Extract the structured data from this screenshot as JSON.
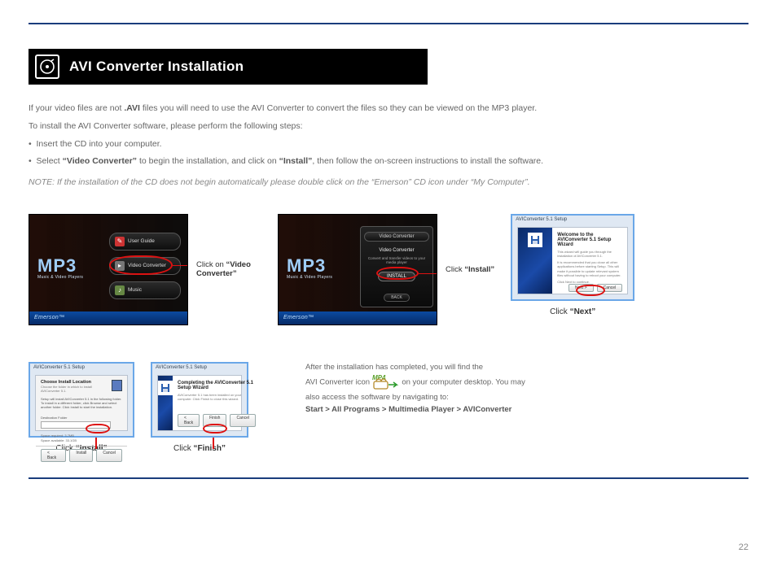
{
  "header": {
    "title": "AVI Converter Installation"
  },
  "intro": {
    "p1_a": "If your video files are not ",
    "p1_b": ".AVI",
    "p1_c": " files you will need to use the AVI Converter to convert the files so they can be viewed on the MP3 player.",
    "p2": "To install the AVI Converter software, please perform the following steps:",
    "li1": "Insert the CD into your computer.",
    "li2_a": "Select ",
    "li2_b": "“Video Converter”",
    "li2_c": " to begin the installation, and click on ",
    "li2_d": "“Install”",
    "li2_e": ", then follow the on-screen instructions to install the software.",
    "note": "NOTE: If the installation of the CD does not begin automatically please double click on the “Emerson” CD icon under “My Computer”."
  },
  "captions": {
    "c1_a": "Click on ",
    "c1_b": "“Video Converter”",
    "c2_a": "Click ",
    "c2_b": "“Install”",
    "c3_a": "Click ",
    "c3_b": "“Next”",
    "c4_a": "Click ",
    "c4_b": "“Install”",
    "c5_a": "Click ",
    "c5_b": "“Finish”"
  },
  "menu": {
    "logo_big": "MP3",
    "logo_sub": "Music & Video Players",
    "item_guide": "User Guide",
    "item_video": "Video Converter",
    "item_music": "Music",
    "brand": "Emerson™"
  },
  "panel": {
    "title": "Video Converter",
    "sub": "Video Converter",
    "desc": "Convert and transfer videos to your media player",
    "install": "INSTALL",
    "back": "BACK"
  },
  "wizard": {
    "win_title": "AVIConverter 5.1 Setup",
    "welcome_h": "Welcome to the AVIConverter 5.1 Setup Wizard",
    "welcome_t1": "This wizard will guide you through the installation of AVIConverter 5.1.",
    "welcome_t2": "It is recommended that you close all other applications before starting Setup. This will make it possible to update relevant system files without having to reboot your computer.",
    "welcome_t3": "Click Next to continue.",
    "btn_next": "Next >",
    "btn_cancel": "Cancel",
    "btn_back": "< Back",
    "btn_install": "Install",
    "btn_finish": "Finish",
    "loc_h": "Choose Install Location",
    "loc_sub": "Choose the folder in which to install AVIConverter 5.1.",
    "loc_para": "Setup will install AVIConverter 5.1 in the following folder. To install in a different folder, click Browse and select another folder. Click Install to start the installation.",
    "loc_field": "Destination Folder",
    "loc_req": "Space required: 3.7MB",
    "loc_avl": "Space available: 33.1GB",
    "complete_h": "Completing the AVIConverter 5.1 Setup Wizard",
    "complete_t": "AVIConverter 5.1 has been installed on your computer. Click Finish to close this wizard."
  },
  "after": {
    "line1": "After the installation has completed, you will find the",
    "line2_a": "AVI Converter icon ",
    "line2_b": " on your computer desktop. You may",
    "line3": "also access the software by navigating to:",
    "line4": "Start > All Programs > Multimedia Player > AVIConverter",
    "mp4_label": "MP4"
  },
  "page_number": "22"
}
